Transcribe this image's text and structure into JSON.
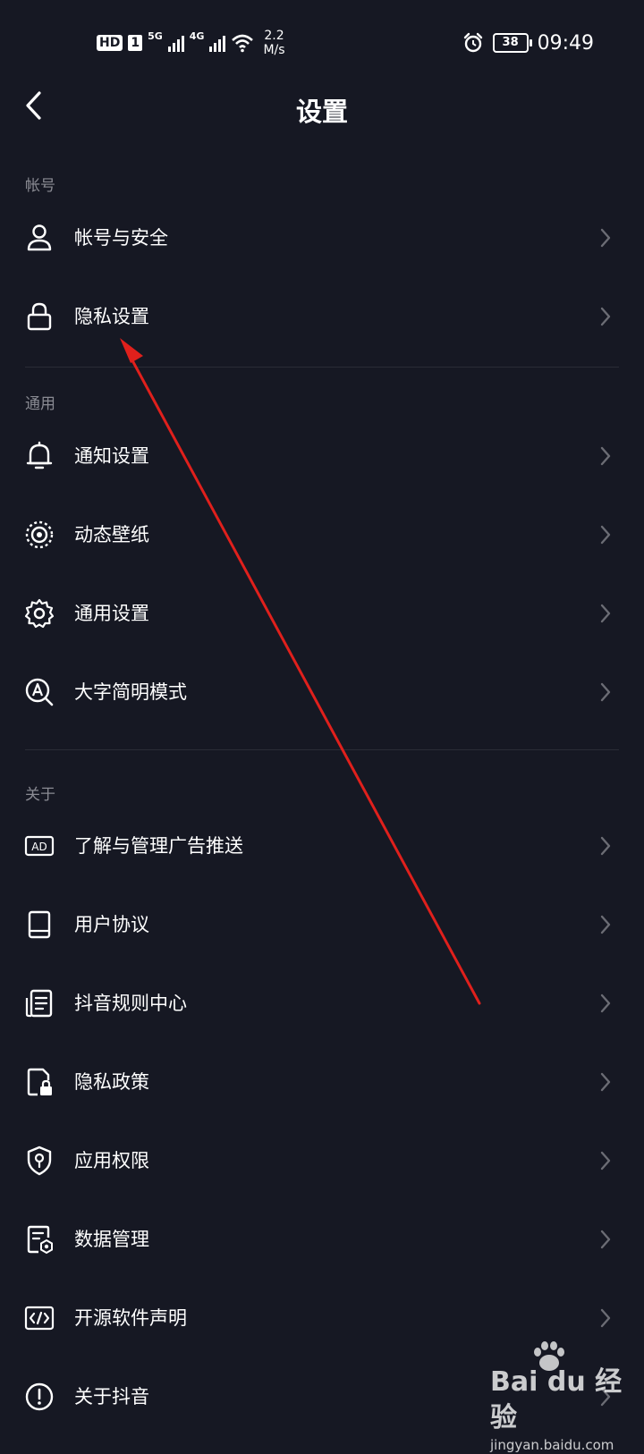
{
  "status_bar": {
    "hd_badge": "HD",
    "sim_badge": "1",
    "net1": "5G",
    "net2": "4G",
    "speed_value": "2.2",
    "speed_unit": "M/s",
    "battery": "38",
    "time": "09:49"
  },
  "nav": {
    "title": "设置"
  },
  "sections": {
    "account": {
      "title": "帐号",
      "items": [
        {
          "label": "帐号与安全",
          "icon": "person-icon"
        },
        {
          "label": "隐私设置",
          "icon": "lock-icon"
        }
      ]
    },
    "general": {
      "title": "通用",
      "items": [
        {
          "label": "通知设置",
          "icon": "bell-icon"
        },
        {
          "label": "动态壁纸",
          "icon": "wallpaper-icon"
        },
        {
          "label": "通用设置",
          "icon": "gear-icon"
        },
        {
          "label": "大字简明模式",
          "icon": "large-text-icon"
        }
      ]
    },
    "about": {
      "title": "关于",
      "items": [
        {
          "label": "了解与管理广告推送",
          "icon": "ad-icon"
        },
        {
          "label": "用户协议",
          "icon": "book-icon"
        },
        {
          "label": "抖音规则中心",
          "icon": "document-icon"
        },
        {
          "label": "隐私政策",
          "icon": "file-lock-icon"
        },
        {
          "label": "应用权限",
          "icon": "shield-icon"
        },
        {
          "label": "数据管理",
          "icon": "data-settings-icon"
        },
        {
          "label": "开源软件声明",
          "icon": "code-icon"
        },
        {
          "label": "关于抖音",
          "icon": "info-icon"
        }
      ]
    }
  },
  "watermark": {
    "main": "Bai du 经验",
    "sub": "jingyan.baidu.com"
  },
  "colors": {
    "background": "#161823",
    "text": "#ffffff",
    "section_text": "#8a8b93",
    "chevron": "#6b6c74",
    "annotation_arrow": "#e0201c"
  }
}
